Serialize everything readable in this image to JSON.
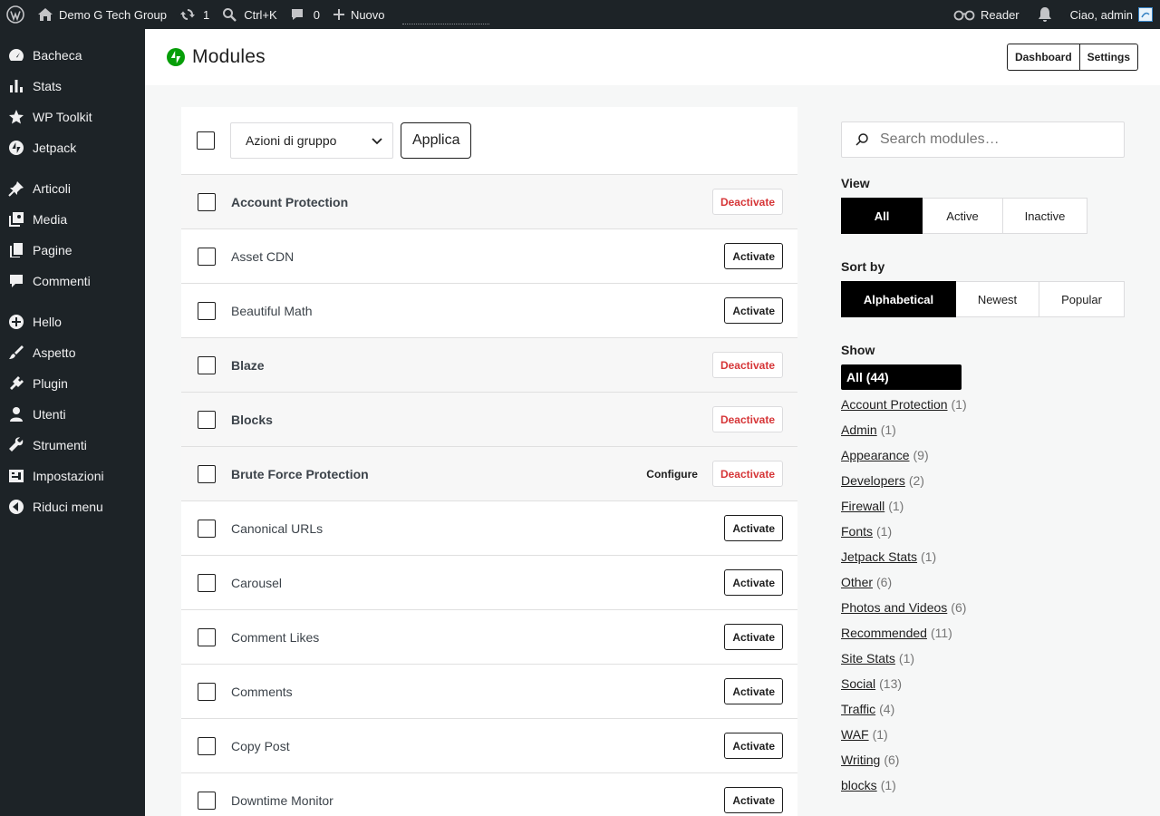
{
  "adminbar": {
    "site_name": "Demo G Tech Group",
    "updates_count": "1",
    "search_shortcut": "Ctrl+K",
    "comments_count": "0",
    "new_label": "Nuovo",
    "reader_label": "Reader",
    "greeting": "Ciao, admin"
  },
  "sidebar": {
    "items": [
      {
        "label": "Bacheca",
        "icon": "dashboard-icon"
      },
      {
        "label": "Stats",
        "icon": "stats-icon"
      },
      {
        "label": "WP Toolkit",
        "icon": "star-icon"
      },
      {
        "label": "Jetpack",
        "icon": "jetpack-icon"
      },
      {
        "label": "Articoli",
        "icon": "pin-icon"
      },
      {
        "label": "Media",
        "icon": "media-icon"
      },
      {
        "label": "Pagine",
        "icon": "pages-icon"
      },
      {
        "label": "Commenti",
        "icon": "comment-icon"
      },
      {
        "label": "Hello",
        "icon": "plus-circle-icon"
      },
      {
        "label": "Aspetto",
        "icon": "brush-icon"
      },
      {
        "label": "Plugin",
        "icon": "plugin-icon"
      },
      {
        "label": "Utenti",
        "icon": "user-icon"
      },
      {
        "label": "Strumenti",
        "icon": "wrench-icon"
      },
      {
        "label": "Impostazioni",
        "icon": "settings-icon"
      },
      {
        "label": "Riduci menu",
        "icon": "collapse-icon"
      }
    ]
  },
  "header": {
    "title": "Modules",
    "dashboard_label": "Dashboard",
    "settings_label": "Settings"
  },
  "bulk": {
    "select_label": "Azioni di gruppo",
    "apply_label": "Applica"
  },
  "labels": {
    "activate": "Activate",
    "deactivate": "Deactivate",
    "configure": "Configure"
  },
  "modules": [
    {
      "name": "Account Protection",
      "active": true,
      "configure": false
    },
    {
      "name": "Asset CDN",
      "active": false,
      "configure": false
    },
    {
      "name": "Beautiful Math",
      "active": false,
      "configure": false
    },
    {
      "name": "Blaze",
      "active": true,
      "configure": false
    },
    {
      "name": "Blocks",
      "active": true,
      "configure": false
    },
    {
      "name": "Brute Force Protection",
      "active": true,
      "configure": true
    },
    {
      "name": "Canonical URLs",
      "active": false,
      "configure": false
    },
    {
      "name": "Carousel",
      "active": false,
      "configure": false
    },
    {
      "name": "Comment Likes",
      "active": false,
      "configure": false
    },
    {
      "name": "Comments",
      "active": false,
      "configure": false
    },
    {
      "name": "Copy Post",
      "active": false,
      "configure": false
    },
    {
      "name": "Downtime Monitor",
      "active": false,
      "configure": false
    }
  ],
  "filters": {
    "search_placeholder": "Search modules…",
    "view_label": "View",
    "view_options": [
      "All",
      "Active",
      "Inactive"
    ],
    "view_selected": "All",
    "sort_label": "Sort by",
    "sort_options": [
      "Alphabetical",
      "Newest",
      "Popular"
    ],
    "sort_selected": "Alphabetical",
    "show_label": "Show",
    "show_selected": "All (44)",
    "categories": [
      {
        "name": "Account Protection",
        "count": "(1)"
      },
      {
        "name": "Admin",
        "count": "(1)"
      },
      {
        "name": "Appearance",
        "count": "(9)"
      },
      {
        "name": "Developers",
        "count": "(2)"
      },
      {
        "name": "Firewall",
        "count": "(1)"
      },
      {
        "name": "Fonts",
        "count": "(1)"
      },
      {
        "name": "Jetpack Stats",
        "count": "(1)"
      },
      {
        "name": "Other",
        "count": "(6)"
      },
      {
        "name": "Photos and Videos",
        "count": "(6)"
      },
      {
        "name": "Recommended",
        "count": "(11)"
      },
      {
        "name": "Site Stats",
        "count": "(1)"
      },
      {
        "name": "Social",
        "count": "(13)"
      },
      {
        "name": "Traffic",
        "count": "(4)"
      },
      {
        "name": "WAF",
        "count": "(1)"
      },
      {
        "name": "Writing",
        "count": "(6)"
      },
      {
        "name": "blocks",
        "count": "(1)"
      }
    ]
  }
}
